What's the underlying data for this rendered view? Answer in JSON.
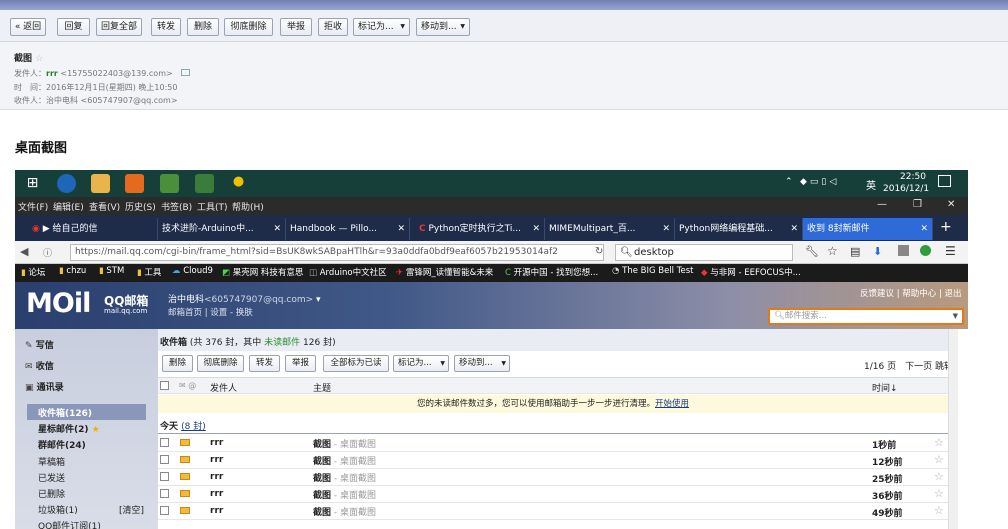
{
  "toolbar": {
    "back": "« 返回",
    "reply": "回复",
    "reply_all": "回复全部",
    "forward": "转发",
    "delete": "删除",
    "delete_perm": "彻底删除",
    "report": "举报",
    "reject": "拒收",
    "mark_as": "标记为...",
    "move_to": "移动到..."
  },
  "mail_header": {
    "subject": "截图",
    "from_label": "发件人：",
    "from_name": "rrr",
    "from_addr": "<15755022403@139.com>",
    "time_label": "时　间：",
    "time_value": "2016年12月1日(星期四) 晚上10:50",
    "to_label": "收件人：",
    "to_name": "治中电科",
    "to_addr": "<605747907@qq.com>"
  },
  "body_title": "桌面截图",
  "taskbar": {
    "time": "22:50",
    "date": "2016/12/1",
    "lang": "英"
  },
  "menubar": [
    "文件(F)",
    "编辑(E)",
    "查看(V)",
    "历史(S)",
    "书签(B)",
    "工具(T)",
    "帮助(H)"
  ],
  "tabs": [
    {
      "label": "▶ 给自己的信"
    },
    {
      "label": "技术进阶-Arduino中..."
    },
    {
      "label": "Handbook — Pillo..."
    },
    {
      "label": "Python定时执行之Ti..."
    },
    {
      "label": "MIMEMultipart_百..."
    },
    {
      "label": "Python网络编程基础..."
    },
    {
      "label": "收到 8封新邮件"
    }
  ],
  "url": "https://mail.qq.com/cgi-bin/frame_html?sid=BsUK8wkSABpaHTlh&r=93a0ddfa0bdf9eaf6057b21953014af2",
  "search_query": "desktop",
  "bookmarks": [
    "论坛",
    "chzu",
    "STM",
    "工具",
    "Cloud9",
    "果壳网 科技有意思",
    "Arduino中文社区",
    "雷锋网_读懂智能&未来",
    "开源中国 - 找到您想...",
    "The BIG Bell Test",
    "与非网 - EEFOCUS中..."
  ],
  "qq": {
    "logo": "MOil",
    "brand": "QQ邮箱",
    "domain": "mail.qq.com",
    "user": "治中电科",
    "user_addr": "<605747907@qq.com>",
    "links": "邮箱首页 | 设置 - 换肤",
    "top_links": "反馈建议 | 帮助中心 | 退出",
    "search_placeholder": "邮件搜索..."
  },
  "sidebar": {
    "write": "写信",
    "receive": "收信",
    "contacts": "通讯录",
    "folders": [
      {
        "label": "收件箱(126)"
      },
      {
        "label": "星标邮件(2)"
      },
      {
        "label": "群邮件(24)"
      },
      {
        "label": "草稿箱"
      },
      {
        "label": "已发送"
      },
      {
        "label": "已删除"
      },
      {
        "label": "垃圾箱(1)"
      },
      {
        "label": "QQ邮件订阅(1)"
      }
    ],
    "clear": "[清空]"
  },
  "inbox": {
    "title": "收件箱",
    "summary_prefix": "(共 376 封，其中 ",
    "summary_unread": "未读邮件",
    "summary_suffix": " 126 封)",
    "actions": [
      "删除",
      "彻底删除",
      "转发",
      "举报",
      "全部标为已读",
      "标记为...",
      "移动到..."
    ],
    "page": "1/16 页",
    "next": "下一页",
    "jump": "跳转",
    "col_sender": "发件人",
    "col_subject": "主题",
    "col_time": "时间↓",
    "notice": "您的未读邮件数过多，您可以使用邮箱助手一步一步进行清理。",
    "notice_link": "开始使用",
    "group_today": "今天",
    "group_count": "(8 封)",
    "rows": [
      {
        "sender": "rrr",
        "subject": "截图",
        "preview": " - 桌面截图",
        "time": "1秒前"
      },
      {
        "sender": "rrr",
        "subject": "截图",
        "preview": " - 桌面截图",
        "time": "12秒前"
      },
      {
        "sender": "rrr",
        "subject": "截图",
        "preview": " - 桌面截图",
        "time": "25秒前"
      },
      {
        "sender": "rrr",
        "subject": "截图",
        "preview": " - 桌面截图",
        "time": "36秒前"
      },
      {
        "sender": "rrr",
        "subject": "截图",
        "preview": " - 桌面截图",
        "time": "49秒前"
      }
    ]
  }
}
